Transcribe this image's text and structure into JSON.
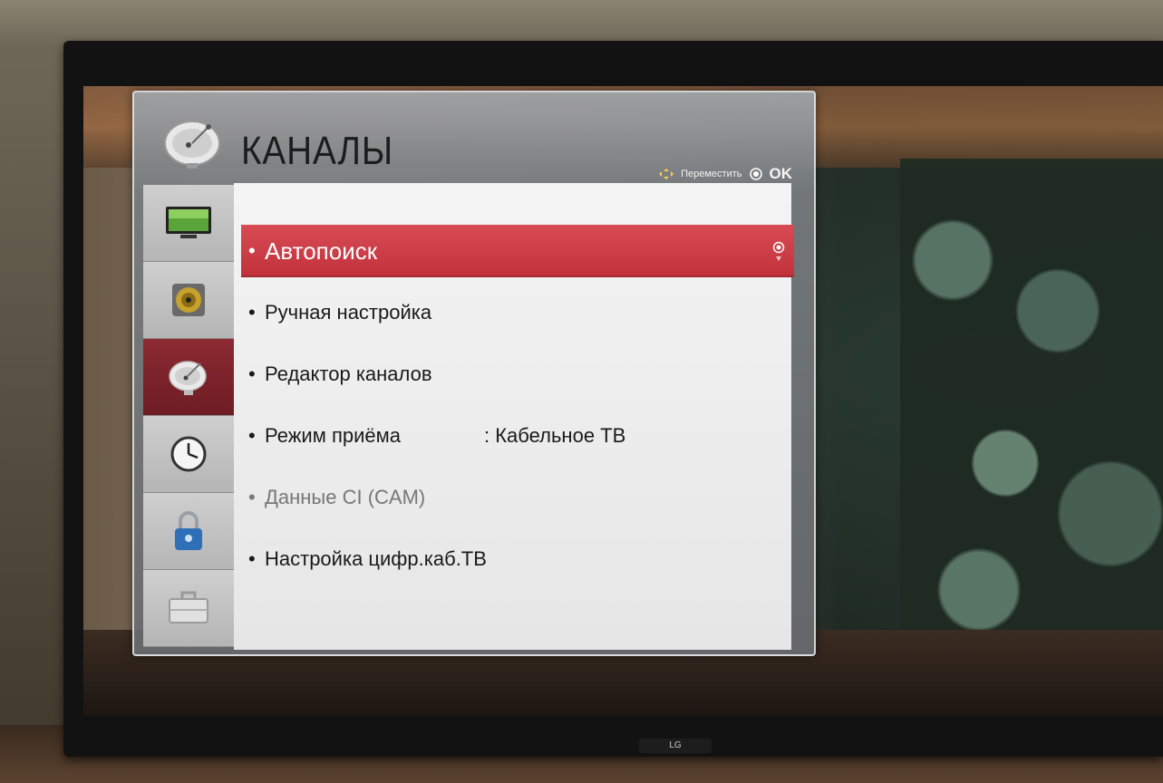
{
  "osd": {
    "title": "КАНАЛЫ",
    "hint_move": "Переместить",
    "hint_ok": "OK"
  },
  "sidebar": {
    "items": [
      {
        "icon": "tv-picture-icon"
      },
      {
        "icon": "speaker-icon"
      },
      {
        "icon": "satellite-dish-icon",
        "active": true
      },
      {
        "icon": "clock-icon"
      },
      {
        "icon": "padlock-icon"
      },
      {
        "icon": "toolbox-icon"
      }
    ]
  },
  "menu": {
    "items": [
      {
        "label": "Автопоиск",
        "selected": true
      },
      {
        "label": "Ручная настройка"
      },
      {
        "label": "Редактор каналов"
      },
      {
        "label": "Режим приёма",
        "value": ": Кабельное ТВ"
      },
      {
        "label": "Данные CI (CAM)",
        "disabled": true
      },
      {
        "label": "Настройка цифр.каб.ТВ"
      }
    ]
  },
  "tv": {
    "brand": "LG"
  },
  "colors": {
    "selection_red": "#c8343e",
    "active_sidebar": "#7a222a",
    "panel_bg": "#ececec"
  }
}
